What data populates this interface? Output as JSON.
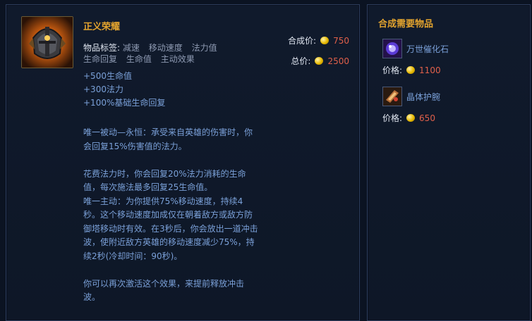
{
  "item": {
    "name": "正义荣耀",
    "tags_label": "物品标签:",
    "tags": [
      "减速",
      "移动速度",
      "法力值",
      "生命回复",
      "生命值",
      "主动效果"
    ],
    "stats": [
      "+500生命值",
      "+300法力",
      "+100%基础生命回复"
    ],
    "description": [
      "唯一被动—永恒：承受来自英雄的伤害时，你会回复15%伤害值的法力。",
      "",
      "花费法力时，你会回复20%法力消耗的生命值，每次施法最多回复25生命值。",
      "唯一主动：为你提供75%移动速度，持续4秒。这个移动速度加成仅在朝着敌方或敌方防御塔移动时有效。在3秒后，你会放出一道冲击波，使附近敌方英雄的移动速度减少75%，持续2秒(冷却时间：90秒)。",
      "",
      "你可以再次激活这个效果，来提前释放冲击波。"
    ],
    "combine_price_label": "合成价:",
    "combine_price": "750",
    "total_price_label": "总价:",
    "total_price": "2500"
  },
  "components": {
    "title": "合成需要物品",
    "price_label": "价格:",
    "items": [
      {
        "name": "万世催化石",
        "price": "1100"
      },
      {
        "name": "晶体护腕",
        "price": "650"
      }
    ]
  },
  "colors": {
    "gold": "#e2a32e",
    "price": "#e0604a",
    "stat_text": "#7aa0d8"
  }
}
